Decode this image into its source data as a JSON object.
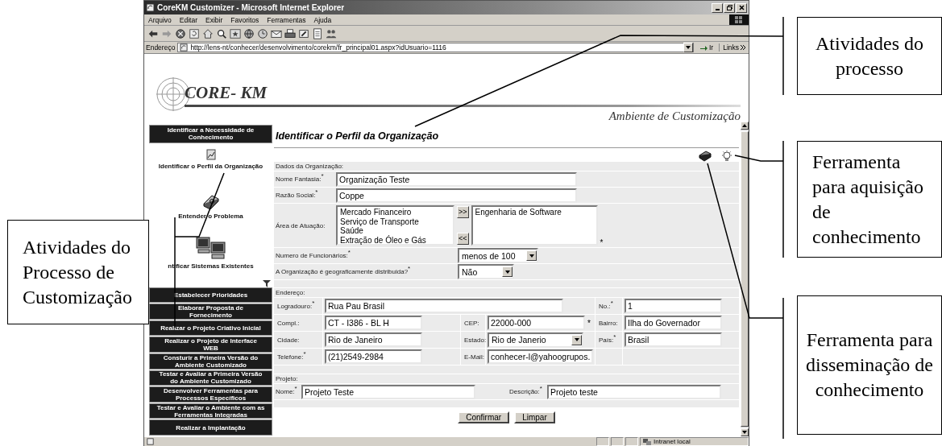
{
  "window": {
    "title": "CoreKM Customizer - Microsoft Internet Explorer"
  },
  "menu": [
    "Arquivo",
    "Editar",
    "Exibir",
    "Favoritos",
    "Ferramentas",
    "Ajuda"
  ],
  "address": {
    "label": "Endereço",
    "url": "http://lens-nt/conhecer/desenvolvimento/corekm/fr_principal01.aspx?idUsuario=1116",
    "go": "Ir",
    "links": "Links"
  },
  "header": {
    "logo": "CORE- KM",
    "subtitle": "Ambiente de Customização"
  },
  "sidebar": {
    "heading": "Identificar a Necessidade de Conhecimento",
    "activities": [
      {
        "kind": "profile",
        "label": "Identificar o Perfil da Organização"
      },
      {
        "kind": "problem",
        "label": "Entender o Problema"
      },
      {
        "kind": "systems",
        "label": "ntificar Sistemas Existentes"
      }
    ],
    "steps": [
      "Estabelecer Prioridades",
      "Elaborar Proposta de Fornecimento",
      "Realizar o Projeto Criativo Inicial",
      "Realizar o Projeto de Interface WEB",
      "Consturir a Primeira Versão do Ambiente Customizado",
      "Testar e Avaliar a Primeira Versão do Ambiente Customizado",
      "Desenvolver Ferramentas para Processos Específicos",
      "Testar e Avaliar o Ambiente com as Ferramentas Integradas",
      "Realizar a Implantação"
    ]
  },
  "page": {
    "title": "Identificar o Perfil da Organização"
  },
  "organization": {
    "heading": "Dados da Organização:",
    "fields": [
      {
        "kind": "text",
        "label": "Nome Fantasia:$^{*}$",
        "value": "Organização Teste"
      },
      {
        "kind": "text",
        "label": "Razão Social:$^{*}$",
        "value": "Coppe"
      },
      {
        "kind": "transfer",
        "label": "Área de Atuação:",
        "options": [
          "Mercado Financeiro",
          "Serviço de Transporte",
          "Saúde",
          "Extração de Óleo e Gás"
        ],
        "chosen": [
          "Engenharia de Software"
        ],
        "add": ">>",
        "remove": "<<",
        "note": "*"
      },
      {
        "kind": "select",
        "label": "Numero de Funcionários:$^{*}$",
        "value": "menos de 100"
      },
      {
        "kind": "select",
        "label": "A Organização é geograficamente distribuida?$^{*}$",
        "value": "Não"
      }
    ]
  },
  "address_form": {
    "heading": "Endereço:",
    "rows": [
      [
        {
          "kind": "wide",
          "label": "Logradouro:$^{*}$",
          "value": "Rua Pau Brasil"
        },
        "",
        {
          "kind": "text",
          "label": "No.:$^{*}$",
          "value": "1"
        }
      ],
      [
        {
          "kind": "text",
          "label": "Compl.:",
          "value": "CT - I386 - BL H"
        },
        {
          "kind": "text",
          "label": "CEP:",
          "value": "22000-000",
          "note": "*"
        },
        {
          "kind": "text",
          "label": "Bairro:",
          "value": "Ilha do Governador"
        }
      ],
      [
        {
          "kind": "text",
          "label": "Cidade:",
          "value": "Rio de Janeiro"
        },
        {
          "kind": "select",
          "label": "Estado:",
          "value": "Rio de Janerio"
        },
        {
          "kind": "text",
          "label": "País:$^{*}$",
          "value": "Brasil"
        }
      ],
      [
        {
          "kind": "text",
          "label": "Telefone:$^{*}$",
          "value": "(21)2549-2984"
        },
        {
          "kind": "text",
          "label": "E-Mail:",
          "value": "conhecer-l@yahoogrupos."
        }
      ]
    ]
  },
  "project": {
    "heading": "Projeto:",
    "fields": [
      {
        "label": "Nome:$^{*}$",
        "value": "Projeto Teste"
      },
      {
        "label": "Descrição:$^{*}$",
        "value": "Projeto teste"
      }
    ]
  },
  "buttons": [
    "Confirmar",
    "Limpar"
  ],
  "status": {
    "zone": "Intranet local"
  },
  "annotations": [
    "Atividades do processo",
    "Ferramenta para aquisição de conhecimento",
    "Ferramenta para disseminação de conhecimento",
    "Atividades do Processo de Customização"
  ]
}
